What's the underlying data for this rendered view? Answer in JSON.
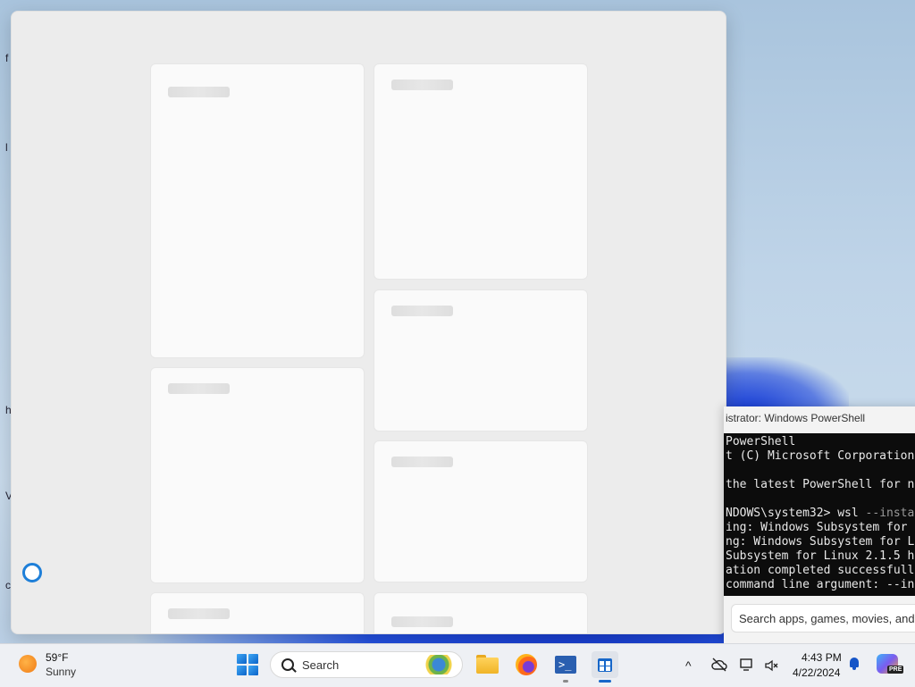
{
  "desktop": {
    "edge_letters": [
      "f",
      "l",
      "h",
      "V",
      "c"
    ]
  },
  "store_window": {
    "loading": true
  },
  "powershell": {
    "title": "istrator: Windows PowerShell",
    "lines": [
      {
        "text": "PowerShell"
      },
      {
        "text": "t (C) Microsoft Corporation"
      },
      {
        "text": ""
      },
      {
        "text": "the latest PowerShell for n"
      },
      {
        "text": ""
      },
      {
        "text": "NDOWS\\system32> wsl ",
        "dim": "--insta"
      },
      {
        "text": "ing: Windows Subsystem for "
      },
      {
        "text": "ng: Windows Subsystem for L"
      },
      {
        "text": "Subsystem for Linux 2.1.5 h"
      },
      {
        "text": "ation completed successfull"
      },
      {
        "text": "command line argument: --in"
      }
    ],
    "store_search_placeholder": "Search apps, games, movies, and"
  },
  "taskbar": {
    "weather": {
      "temp": "59°F",
      "condition": "Sunny",
      "icon": "sun-icon"
    },
    "search": {
      "label": "Search"
    },
    "apps": [
      {
        "name": "file-explorer",
        "icon": "folder-icon"
      },
      {
        "name": "firefox",
        "icon": "firefox-icon"
      },
      {
        "name": "powershell",
        "icon": "powershell-icon"
      },
      {
        "name": "microsoft-store",
        "icon": "store-icon",
        "active": true
      }
    ],
    "tray": {
      "chevron": "^",
      "time": "4:43 PM",
      "date": "4/22/2024",
      "copilot_badge": "PRE"
    }
  }
}
